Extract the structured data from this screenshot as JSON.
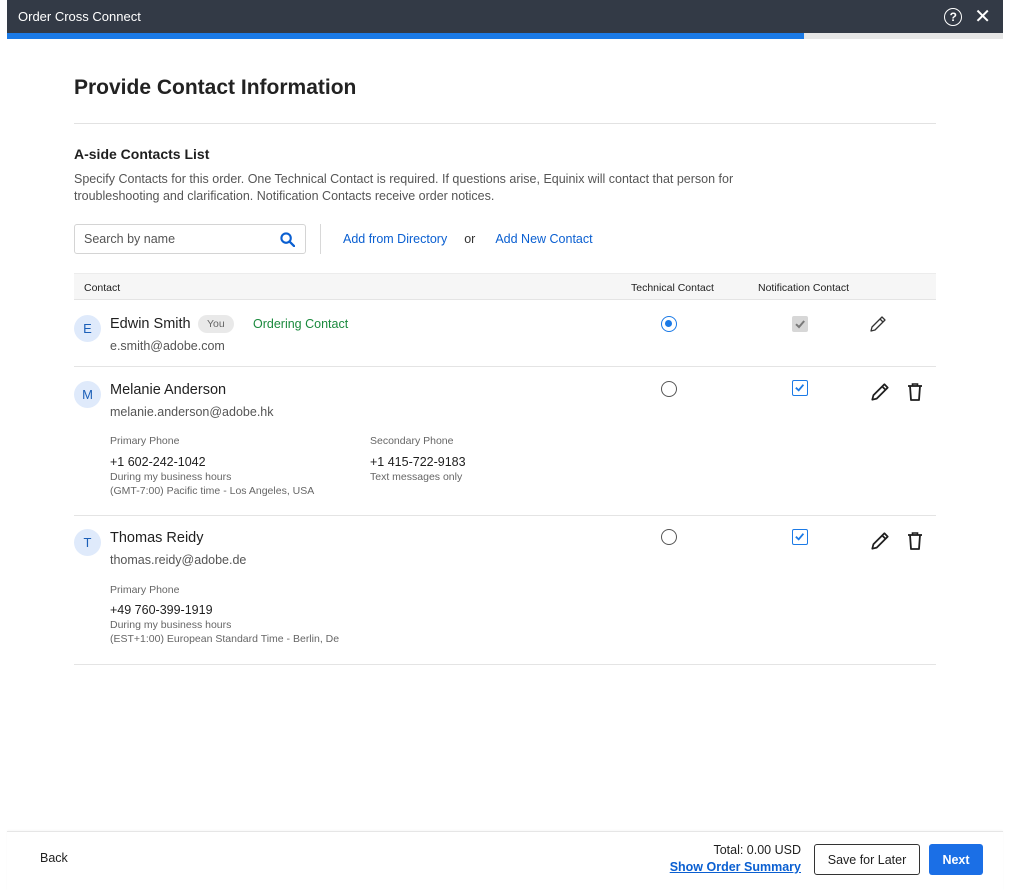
{
  "window": {
    "title": "Order Cross Connect",
    "help_icon": "help-circle-icon",
    "close_icon": "close-icon",
    "progress_fraction": 0.8
  },
  "page": {
    "title": "Provide Contact Information"
  },
  "section": {
    "title": "A-side Contacts List",
    "description": "Specify Contacts for this order. One Technical Contact is required. If questions arise, Equinix will contact that person for troubleshooting and clarification. Notification Contacts receive order notices."
  },
  "search": {
    "placeholder": "Search by name",
    "icon": "search-icon"
  },
  "links": {
    "add_from_directory": "Add from Directory",
    "or": "or",
    "add_new_contact": "Add New Contact"
  },
  "table": {
    "headers": {
      "contact": "Contact",
      "technical": "Technical Contact",
      "notification": "Notification Contact"
    }
  },
  "contacts": [
    {
      "initial": "E",
      "name": "Edwin Smith",
      "badge": "You",
      "role": "Ordering Contact",
      "email": "e.smith@adobe.com",
      "technical": true,
      "notification": true,
      "notification_disabled": true
    },
    {
      "initial": "M",
      "name": "Melanie Anderson",
      "email": "melanie.anderson@adobe.hk",
      "technical": false,
      "notification": true,
      "primary_label": "Primary Phone",
      "primary_number": "+1 602-242-1042",
      "primary_note1": "During my business hours",
      "primary_note2": "(GMT-7:00) Pacific time - Los Angeles, USA",
      "secondary_label": "Secondary Phone",
      "secondary_number": "+1 415-722-9183",
      "secondary_note": "Text messages only"
    },
    {
      "initial": "T",
      "name": "Thomas Reidy",
      "email": "thomas.reidy@adobe.de",
      "technical": false,
      "notification": true,
      "primary_label": "Primary Phone",
      "primary_number": "+49 760-399-1919",
      "primary_note1": "During my business hours",
      "primary_note2": "(EST+1:00) European Standard Time - Berlin, De"
    }
  ],
  "footer": {
    "back": "Back",
    "total": "Total: 0.00 USD",
    "show_summary": "Show Order Summary",
    "save_for_later": "Save for Later",
    "next": "Next"
  },
  "colors": {
    "accent": "#1b7ae6",
    "titlebar": "#333a46",
    "ordering_green": "#1b8a3e"
  }
}
